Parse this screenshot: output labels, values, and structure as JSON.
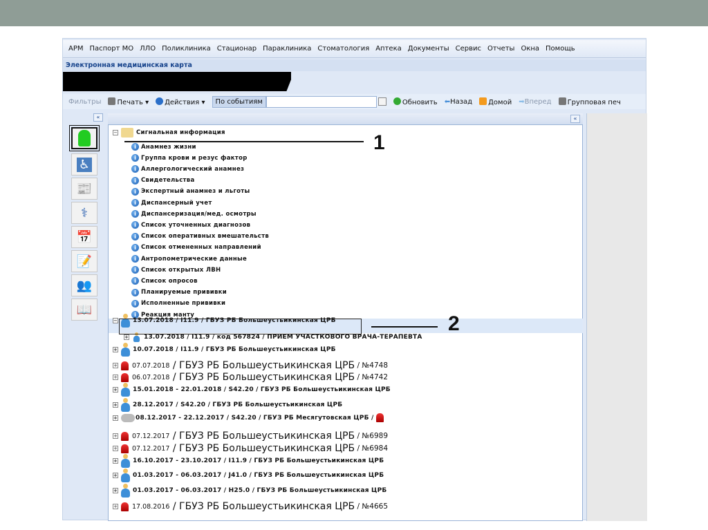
{
  "menu": [
    "АРМ",
    "Паспорт МО",
    "ЛЛО",
    "Поликлиника",
    "Стационар",
    "Параклиника",
    "Стоматология",
    "Аптека",
    "Документы",
    "Сервис",
    "Отчеты",
    "Окна",
    "Помощь"
  ],
  "window_title": "Электронная медицинская карта",
  "toolbar": {
    "filters": "Фильтры",
    "print": "Печать ▾",
    "actions": "Действия ▾",
    "mode": "По событиям",
    "search_value": "",
    "refresh": "Обновить",
    "back": "Назад",
    "home": "Домой",
    "forward": "Вперед",
    "group_print": "Групповая печ"
  },
  "collapse": "«",
  "tree": {
    "root": "Сигнальная информация",
    "children": [
      "Анамнез жизни",
      "Группа крови и резус фактор",
      "Аллергологический анамнез",
      "Свидетельства",
      "Экспертный анамнез и льготы",
      "Диспансерный учет",
      "Диспансеризация/мед. осмотры",
      "Список уточненных диагнозов",
      "Список оперативных вмешательств",
      "Список отмененных направлений",
      "Антропометрические данные",
      "Список открытых ЛВН",
      "Список опросов",
      "Планируемые прививки",
      "Исполненные прививки",
      "Реакция манту"
    ],
    "events": [
      {
        "type": "person",
        "text": "13.07.2018  /  I11.9  /  ГБУЗ РБ Большеустьикинская ЦРБ",
        "expanded": true
      },
      {
        "type": "person-small",
        "text": "13.07.2018  /  I11.9  /  код 567824  /  ПРИЕМ УЧАСТКОВОГО ВРАЧА-ТЕРАПЕВТА"
      },
      {
        "type": "person",
        "text": "10.07.2018  /  I11.9  /  ГБУЗ РБ Большеустьикинская ЦРБ"
      },
      {
        "type": "alert",
        "date": "07.07.2018",
        "org": "ГБУЗ РБ Большеустьикинская ЦРБ",
        "num": "№4748"
      },
      {
        "type": "alert",
        "date": "06.07.2018",
        "org": "ГБУЗ РБ Большеустьикинская ЦРБ",
        "num": "№4742"
      },
      {
        "type": "person",
        "text": "15.01.2018 - 22.01.2018  /  S42.20  /  ГБУЗ РБ Большеустьикинская ЦРБ"
      },
      {
        "type": "person",
        "text": "28.12.2017  /  S42.20  /  ГБУЗ РБ Большеустьикинская ЦРБ"
      },
      {
        "type": "hospital",
        "text": "08.12.2017 - 22.12.2017 / S42.20 / ГБУЗ РБ Месягутовская ЦРБ /"
      },
      {
        "type": "alert",
        "date": "07.12.2017",
        "org": "ГБУЗ РБ Большеустьикинская ЦРБ",
        "num": "№6989"
      },
      {
        "type": "alert",
        "date": "07.12.2017",
        "org": "ГБУЗ РБ Большеустьикинская ЦРБ",
        "num": "№6984"
      },
      {
        "type": "person",
        "text": "16.10.2017 - 23.10.2017  /  I11.9  /  ГБУЗ РБ Большеустьикинская ЦРБ"
      },
      {
        "type": "person",
        "text": "01.03.2017 - 06.03.2017  /  J41.0  /  ГБУЗ РБ Большеустьикинская ЦРБ"
      },
      {
        "type": "person",
        "text": "01.03.2017 - 06.03.2017  /  H25.0  /  ГБУЗ РБ Большеустьикинская ЦРБ"
      },
      {
        "type": "alert",
        "date": "17.08.2016",
        "org": "ГБУЗ РБ Большеустьикинская ЦРБ",
        "num": "№4665"
      }
    ]
  },
  "annotations": [
    "1",
    "2"
  ]
}
